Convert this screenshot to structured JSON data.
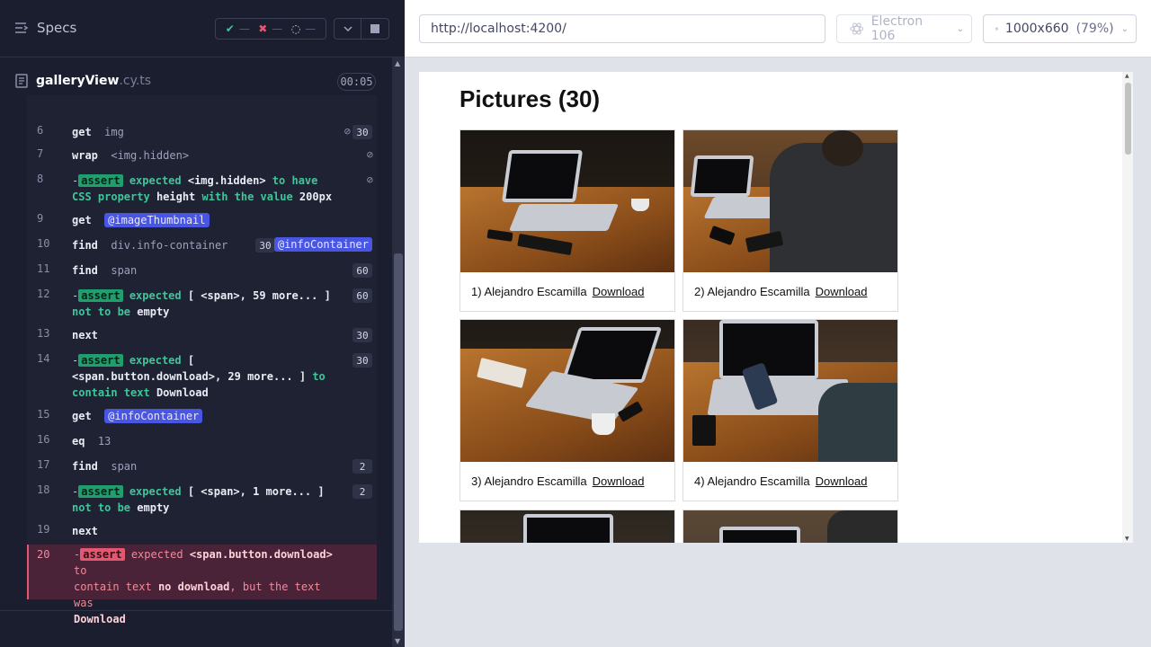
{
  "reporter": {
    "specs_label": "Specs",
    "stats": {
      "passed": "—",
      "failed": "—",
      "pending": "—"
    },
    "spec_name": "galleryView",
    "spec_ext": ".cy.ts",
    "duration": "00:05"
  },
  "commands": [
    {
      "num": "6",
      "name": "get",
      "arg": "img",
      "count": "30"
    },
    {
      "num": "7",
      "name": "wrap",
      "arg": "<img.hidden>"
    },
    {
      "num": "8",
      "badge": "assert",
      "text1": "expected",
      "v1": "<img.hidden>",
      "text2": "to have",
      "text3": "CSS property",
      "v2": "height",
      "text4": "with the value",
      "v3": "200px"
    },
    {
      "num": "9",
      "name": "get",
      "alias": "@imageThumbnail"
    },
    {
      "num": "10",
      "name": "find",
      "arg": "div.info-container",
      "count": "30",
      "alias": "@infoContainer"
    },
    {
      "num": "11",
      "name": "find",
      "arg": "span",
      "count": "60"
    },
    {
      "num": "12",
      "badge": "assert",
      "text1": "expected",
      "v1": "[ <span>, 59 more... ]",
      "text2": "not to be",
      "v2": "empty",
      "count": "60"
    },
    {
      "num": "13",
      "name": "next",
      "count": "30"
    },
    {
      "num": "14",
      "badge": "assert",
      "text1": "expected",
      "v1": "[",
      "v1b": "<span.button.download>, 29 more... ]",
      "text2": "to",
      "text3": "contain text",
      "v2": "Download",
      "count": "30"
    },
    {
      "num": "15",
      "name": "get",
      "alias": "@infoContainer"
    },
    {
      "num": "16",
      "name": "eq",
      "arg": "13"
    },
    {
      "num": "17",
      "name": "find",
      "arg": "span",
      "count": "2"
    },
    {
      "num": "18",
      "badge": "assert",
      "text1": "expected",
      "v1": "[ <span>, 1 more... ]",
      "text2": "not to be",
      "v2": "empty",
      "count": "2"
    },
    {
      "num": "19",
      "name": "next"
    },
    {
      "num": "20",
      "badge": "assert",
      "text1": "expected",
      "v1": "<span.button.download>",
      "text2": "to",
      "text3": "contain text",
      "v2": "no download",
      "text4": ", but the text was",
      "v3": "Download"
    }
  ],
  "aut": {
    "url": "http://localhost:4200/",
    "browser": "Electron 106",
    "viewport": "1000x660",
    "zoom": "(79%)",
    "page_title": "Pictures (30)",
    "cards": [
      {
        "caption": "1) Alejandro Escamilla",
        "link": "Download"
      },
      {
        "caption": "2) Alejandro Escamilla",
        "link": "Download"
      },
      {
        "caption": "3) Alejandro Escamilla",
        "link": "Download"
      },
      {
        "caption": "4) Alejandro Escamilla",
        "link": "Download"
      }
    ]
  },
  "colors": {
    "pass": "#40c59b",
    "fail": "#e45770",
    "alias": "#4956e3",
    "panel": "#1b1e2e"
  }
}
